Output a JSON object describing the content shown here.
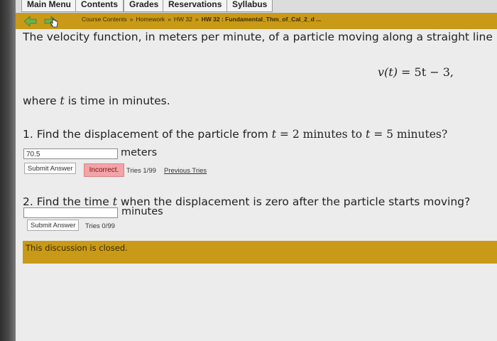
{
  "menu": {
    "tabs": [
      "Main Menu",
      "Contents",
      "Grades",
      "Reservations",
      "Syllabus"
    ]
  },
  "breadcrumb": {
    "items": [
      "Course Contents",
      "Homework",
      "HW 32"
    ],
    "separator": "»",
    "current": "HW 32 : Fundamental_Thm_of_Cal_2_d ..."
  },
  "problem": {
    "intro": "The velocity function, in meters per minute, of a particle moving along a straight line is",
    "equation_lhs": "v(t)",
    "equation_rhs": "= 5t − 3,",
    "where_prefix": "where ",
    "where_var": "t",
    "where_suffix": " is time in minutes."
  },
  "question1": {
    "text_a": "1. Find the displacement of the particle from ",
    "text_b": " = 2 minutes to ",
    "text_c": " = 5 minutes?",
    "var": "t",
    "answer_value": "70.5",
    "unit": "meters",
    "submit_label": "Submit Answer",
    "status": "Incorrect.",
    "tries": "Tries 1/99",
    "previous_tries": "Previous Tries"
  },
  "question2": {
    "text_a": "2. Find the time ",
    "var": "t",
    "text_b": " when the displacement is zero after the particle starts moving?",
    "answer_value": "",
    "unit": "minutes",
    "submit_label": "Submit Answer",
    "tries": "Tries 0/99"
  },
  "discussion": {
    "text": "This discussion is closed."
  },
  "colors": {
    "gold_bar": "#c99a18",
    "incorrect_bg": "#f2a4a8",
    "nav_arrow": "#6ab04c"
  }
}
